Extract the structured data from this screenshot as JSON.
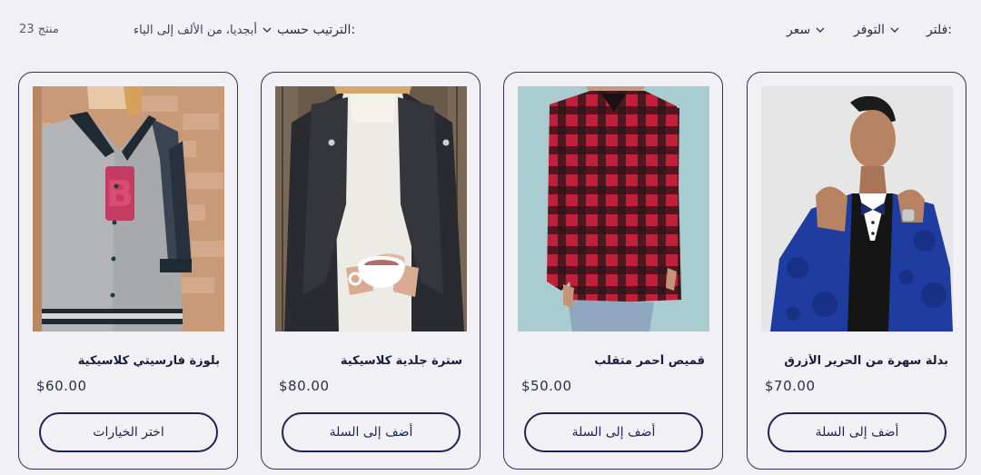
{
  "toolbar": {
    "filter_label": "فلتر:",
    "availability_label": "التوفر",
    "price_label": "سعر",
    "sort_label": "الترتيب حسب:",
    "sort_value": "أبجديا، من الألف إلى الياء",
    "product_count": "23 منتج"
  },
  "products": [
    {
      "name": "بلوزة فارسيتي كلاسيكية",
      "price": "$60.00",
      "button": "اختر الخيارات",
      "image": "varsity-jacket-photo"
    },
    {
      "name": "سترة جلدية كلاسيكية",
      "price": "$80.00",
      "button": "أضف إلى السلة",
      "image": "leather-jacket-photo"
    },
    {
      "name": "قميص أحمر متقلب",
      "price": "$50.00",
      "button": "أضف إلى السلة",
      "image": "red-plaid-shirt-photo"
    },
    {
      "name": "بدلة سهرة من الحرير الأزرق",
      "price": "$70.00",
      "button": "أضف إلى السلة",
      "image": "blue-tuxedo-photo"
    }
  ],
  "colors": {
    "background": "#f1f1f5",
    "accent": "#1f2350"
  }
}
